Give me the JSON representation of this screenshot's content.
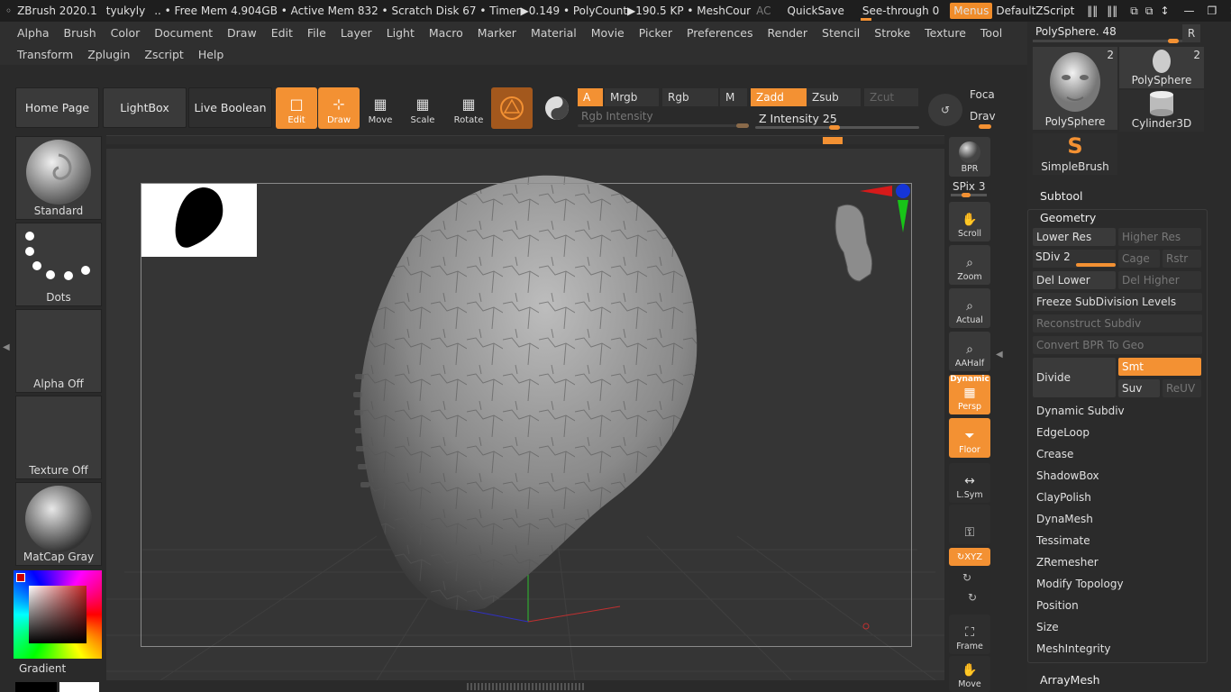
{
  "titlebar": {
    "app": "ZBrush 2020.1",
    "user": "tyukyly",
    "stats": "..  • Free Mem 4.904GB • Active Mem 832 • Scratch Disk 67 •  Timer▶0.149 • PolyCount▶190.5 KP  • MeshCour",
    "ac": "AC",
    "quicksave": "QuickSave",
    "seethrough": "See-through  0",
    "menus": "Menus",
    "script": "DefaultZScript"
  },
  "menubar1": [
    "Alpha",
    "Brush",
    "Color",
    "Document",
    "Draw",
    "Edit",
    "File",
    "Layer",
    "Light",
    "Macro",
    "Marker",
    "Material",
    "Movie",
    "Picker",
    "Preferences",
    "Render",
    "Stencil",
    "Stroke",
    "Texture",
    "Tool"
  ],
  "menubar2": [
    "Transform",
    "Zplugin",
    "Zscript",
    "Help"
  ],
  "toolbar": {
    "home": "Home Page",
    "lightbox": "LightBox",
    "liveboolean": "Live Boolean",
    "edit": "Edit",
    "draw": "Draw",
    "move": "Move",
    "scale": "Scale",
    "rotate": "Rotate",
    "a": "A",
    "mrgb": "Mrgb",
    "rgb": "Rgb",
    "m": "M",
    "zadd": "Zadd",
    "zsub": "Zsub",
    "zcut": "Zcut",
    "rgb_intensity": "Rgb Intensity",
    "z_intensity": "Z Intensity 25",
    "focal": "Foca",
    "draw2": "Drav"
  },
  "leftshelf": {
    "brush": "Standard",
    "stroke": "Dots",
    "alpha": "Alpha Off",
    "texture": "Texture Off",
    "material": "MatCap Gray",
    "gradient": "Gradient"
  },
  "rightshelf": {
    "bpr": "BPR",
    "spix": "SPix 3",
    "scroll": "Scroll",
    "zoom": "Zoom",
    "actual": "Actual",
    "aahalf": "AAHalf",
    "dynamic": "Dynamic",
    "persp": "Persp",
    "floor": "Floor",
    "lsym": "L.Sym",
    "xyz": "↻XYZ",
    "frame": "Frame",
    "move": "Move"
  },
  "palette": {
    "polysphere_slider": "PolySphere. 48",
    "r": "R",
    "tools": [
      {
        "name": "PolySphere",
        "count": "2"
      },
      {
        "name": "PolySphere",
        "count": "2"
      },
      {
        "name": "Cylinder3D",
        "count": ""
      },
      {
        "name": "SimpleBrush",
        "count": ""
      }
    ],
    "subtool": "Subtool",
    "geometry": "Geometry",
    "lower_res": "Lower Res",
    "higher_res": "Higher Res",
    "sdiv": "SDiv 2",
    "cage": "Cage",
    "rstr": "Rstr",
    "del_lower": "Del Lower",
    "del_higher": "Del Higher",
    "freeze": "Freeze SubDivision Levels",
    "reconstruct": "Reconstruct Subdiv",
    "convert_bpr": "Convert BPR To Geo",
    "divide": "Divide",
    "smt": "Smt",
    "suv": "Suv",
    "reuv": "ReUV",
    "sections": [
      "Dynamic Subdiv",
      "EdgeLoop",
      "Crease",
      "ShadowBox",
      "ClayPolish",
      "DynaMesh",
      "Tessimate",
      "ZRemesher",
      "Modify Topology",
      "Position",
      "Size",
      "MeshIntegrity"
    ],
    "arraymesh": "ArrayMesh"
  },
  "colors": {
    "accent": "#f39133",
    "background": "#2a2a2a",
    "canvas": "#353535"
  }
}
